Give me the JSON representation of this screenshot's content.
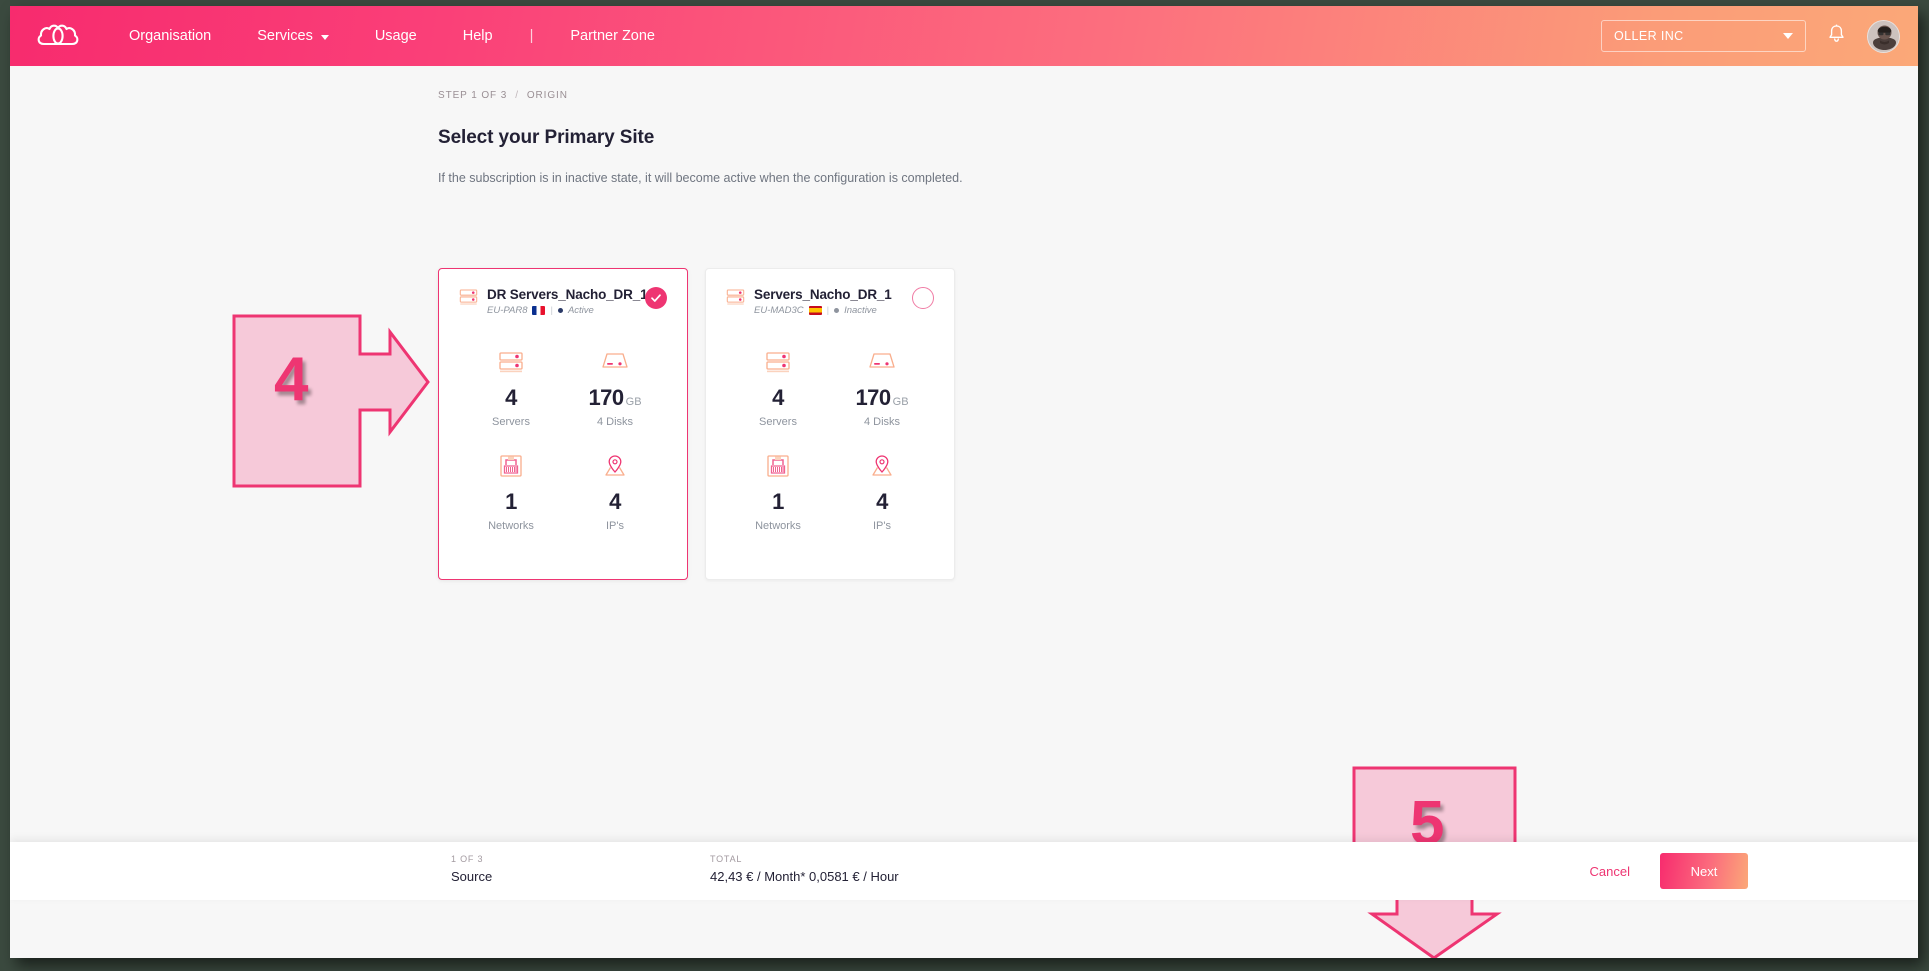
{
  "header": {
    "logo_icon": "cloud-logo-icon",
    "nav": [
      {
        "label": "Organisation",
        "has_caret": false
      },
      {
        "label": "Services",
        "has_caret": true
      },
      {
        "label": "Usage",
        "has_caret": false
      },
      {
        "label": "Help",
        "has_caret": false
      }
    ],
    "separator": "|",
    "partner_zone": "Partner Zone",
    "org_selector": {
      "value": "OLLER INC",
      "icon": "chevron-down-icon"
    },
    "notifications_icon": "bell-icon",
    "avatar_icon": "user-avatar",
    "accent_start": "#f72b6e",
    "accent_end": "#fba878"
  },
  "breadcrumb": {
    "step": "STEP 1 OF 3",
    "separator": "/",
    "current": "ORIGIN"
  },
  "page": {
    "title": "Select your Primary Site",
    "subtitle": "If the subscription is in inactive state, it will become active when the configuration is completed."
  },
  "cards": [
    {
      "title": "DR Servers_Nacho_DR_1",
      "region": "EU-PAR8",
      "flag": "fr",
      "status": "Active",
      "status_state": "active",
      "selected": true,
      "stats": [
        {
          "icon": "server-icon",
          "value": "4",
          "unit": "",
          "label": "Servers"
        },
        {
          "icon": "disk-icon",
          "value": "170",
          "unit": "GB",
          "label": "4 Disks"
        },
        {
          "icon": "network-icon",
          "value": "1",
          "unit": "",
          "label": "Networks"
        },
        {
          "icon": "location-pin-icon",
          "value": "4",
          "unit": "",
          "label": "IP's"
        }
      ]
    },
    {
      "title": "Servers_Nacho_DR_1",
      "region": "EU-MAD3C",
      "flag": "es",
      "status": "Inactive",
      "status_state": "inactive",
      "selected": false,
      "stats": [
        {
          "icon": "server-icon",
          "value": "4",
          "unit": "",
          "label": "Servers"
        },
        {
          "icon": "disk-icon",
          "value": "170",
          "unit": "GB",
          "label": "4 Disks"
        },
        {
          "icon": "network-icon",
          "value": "1",
          "unit": "",
          "label": "Networks"
        },
        {
          "icon": "location-pin-icon",
          "value": "4",
          "unit": "",
          "label": "IP's"
        }
      ]
    }
  ],
  "annotations": [
    {
      "number": "4",
      "direction": "right",
      "color": "#ee3572",
      "fill": "#f6c9d9"
    },
    {
      "number": "5",
      "direction": "down",
      "color": "#ee3572",
      "fill": "#f6c9d9"
    }
  ],
  "footer": {
    "step_label": "1 OF 3",
    "step_value": "Source",
    "total_label": "TOTAL",
    "total_value": "42,43 € / Month*  0,0581 € / Hour",
    "cancel_label": "Cancel",
    "next_label": "Next"
  }
}
